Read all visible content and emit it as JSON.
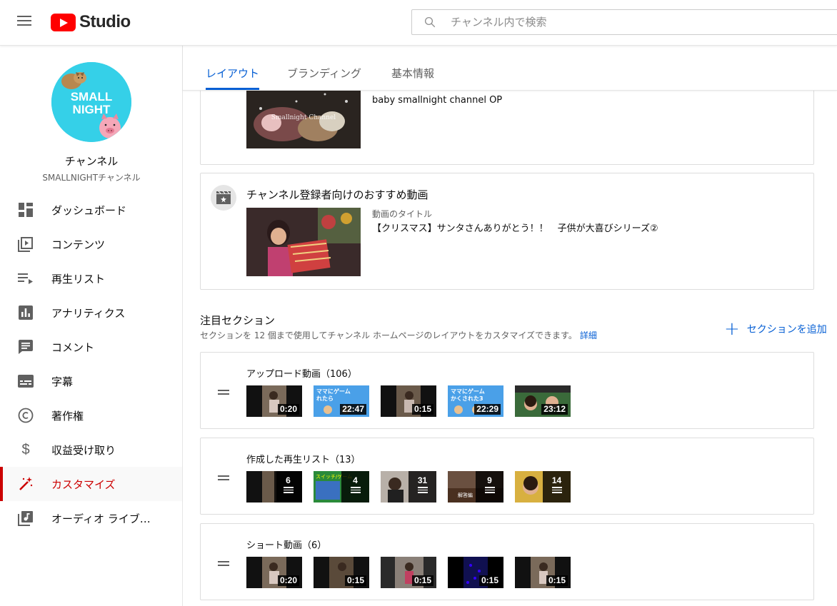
{
  "header": {
    "logo_text": "Studio",
    "search_placeholder": "チャンネル内で検索"
  },
  "sidebar": {
    "channel_label": "チャンネル",
    "channel_name": "SMALLNIGHTチャンネル",
    "avatar_text_1": "SMALL",
    "avatar_text_2": "NIGHT",
    "items": [
      {
        "label": "ダッシュボード",
        "icon": "dashboard-icon"
      },
      {
        "label": "コンテンツ",
        "icon": "content-icon"
      },
      {
        "label": "再生リスト",
        "icon": "playlist-icon"
      },
      {
        "label": "アナリティクス",
        "icon": "analytics-icon"
      },
      {
        "label": "コメント",
        "icon": "comment-icon"
      },
      {
        "label": "字幕",
        "icon": "subtitles-icon"
      },
      {
        "label": "著作権",
        "icon": "copyright-icon"
      },
      {
        "label": "収益受け取り",
        "icon": "dollar-icon"
      },
      {
        "label": "カスタマイズ",
        "icon": "magic-wand-icon",
        "active": true
      },
      {
        "label": "オーディオ ライブ…",
        "icon": "audio-library-icon"
      }
    ]
  },
  "tabs": [
    {
      "label": "レイアウト",
      "active": true
    },
    {
      "label": "ブランディング"
    },
    {
      "label": "基本情報"
    }
  ],
  "trailer_card": {
    "video_title": "baby smallnight channel OP",
    "thumb_overlay": "Smallnight Channel"
  },
  "featured_card": {
    "title": "チャンネル登録者向けのおすすめ動画",
    "video_label": "動画のタイトル",
    "video_title": "【クリスマス】サンタさんありがとう！！　子供が大喜びシリーズ②"
  },
  "featured_sections": {
    "title": "注目セクション",
    "description": "セクションを 12 個まで使用してチャンネル ホームページのレイアウトをカスタマイズできます。",
    "details_link": "詳細",
    "add_button": "セクションを追加"
  },
  "shelves": [
    {
      "title": "アップロード動画（106）",
      "items": [
        {
          "duration": "0:20"
        },
        {
          "duration": "22:47",
          "caption_1": "ママにゲーム",
          "caption_2": "れたら"
        },
        {
          "duration": "0:15"
        },
        {
          "duration": "22:29",
          "caption_1": "ママにゲーム",
          "caption_2": "かくされた3"
        },
        {
          "duration": "23:12"
        }
      ]
    },
    {
      "title": "作成した再生リスト（13）",
      "items": [
        {
          "count": "6"
        },
        {
          "count": "4",
          "caption_1": "スイッチ/ゲーム"
        },
        {
          "count": "31"
        },
        {
          "count": "9",
          "caption_1": "解答編"
        },
        {
          "count": "14"
        }
      ]
    },
    {
      "title": "ショート動画（6）",
      "items": [
        {
          "duration": "0:20"
        },
        {
          "duration": "0:15"
        },
        {
          "duration": "0:15"
        },
        {
          "duration": "0:15"
        },
        {
          "duration": "0:15"
        }
      ]
    }
  ],
  "colors": {
    "accent": "#065fd4",
    "active_nav": "#cc0000",
    "youtube_red": "#ff0000",
    "avatar_bg": "#35d0e8"
  }
}
